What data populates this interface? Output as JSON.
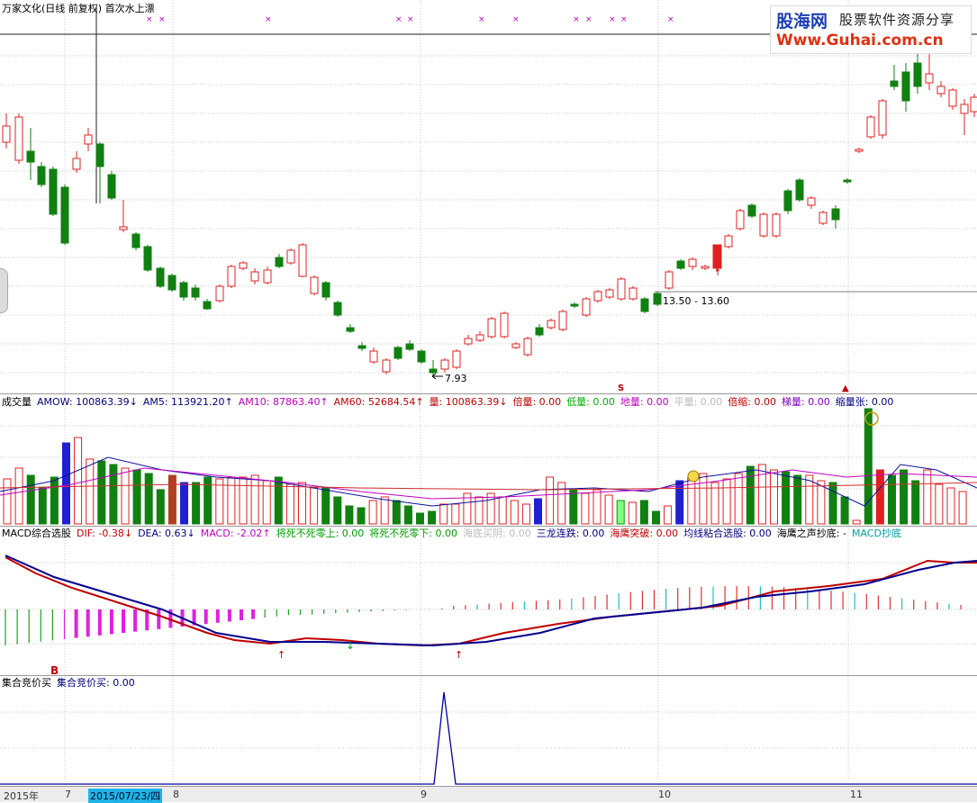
{
  "main": {
    "title": "万家文化(日线 前复权) 首次水上漂",
    "min_label": "7.93",
    "range_label": "13.50 - 13.60"
  },
  "watermark": {
    "logo": "股海网",
    "slogan": "股票软件资源分享",
    "url": "Www.Guhai.com.cn"
  },
  "volume": {
    "items": [
      {
        "label": "成交量",
        "color": "#000000"
      },
      {
        "label": "AMOW: 100863.39",
        "color": "#000080",
        "arrow": "↓"
      },
      {
        "label": "AM5: 113921.20",
        "color": "#000080",
        "arrow": "↑"
      },
      {
        "label": "AM10: 87863.40",
        "color": "#c000c0",
        "arrow": "↑"
      },
      {
        "label": "AM60: 52684.54",
        "color": "#c00000",
        "arrow": "↑"
      },
      {
        "label": "量: 100863.39",
        "color": "#c00000",
        "arrow": "↓"
      },
      {
        "label": "倍量: 0.00",
        "color": "#c00000"
      },
      {
        "label": "低量: 0.00",
        "color": "#00b000"
      },
      {
        "label": "地量: 0.00",
        "color": "#c000c0"
      },
      {
        "label": "平量: 0.00",
        "color": "#bbbbbb"
      },
      {
        "label": "倍缩: 0.00",
        "color": "#c00000"
      },
      {
        "label": "梯量: 0.00",
        "color": "#8000c0"
      },
      {
        "label": "缩量张: 0.00",
        "color": "#000080"
      }
    ]
  },
  "macd": {
    "items": [
      {
        "label": "MACD综合选股",
        "color": "#000000"
      },
      {
        "label": "DIF: -0.38",
        "color": "#c00000",
        "arrow": "↓"
      },
      {
        "label": "DEA: 0.63",
        "color": "#000080",
        "arrow": "↓"
      },
      {
        "label": "MACD: -2.02",
        "color": "#c000c0",
        "arrow": "↑"
      },
      {
        "label": "将死不死零上: 0.00",
        "color": "#00a000"
      },
      {
        "label": "将死不死零下: 0.00",
        "color": "#00a000"
      },
      {
        "label": "海底买阴: 0.00",
        "color": "#bbbbbb"
      },
      {
        "label": "三龙连跌: 0.00",
        "color": "#000080"
      },
      {
        "label": "海鹰突破: 0.00",
        "color": "#c00000"
      },
      {
        "label": "均线粘合选股: 0.00",
        "color": "#000080"
      },
      {
        "label": "海鹰之声抄底: -",
        "color": "#000000"
      },
      {
        "label": "MACD抄底",
        "color": "#00a0a0"
      }
    ],
    "marker_b": "B"
  },
  "auction": {
    "items": [
      {
        "label": "集合竞价买",
        "color": "#000000"
      },
      {
        "label": "集合竞价买: 0.00",
        "color": "#000080"
      }
    ]
  },
  "datebar": {
    "year": "2015年",
    "m7": "7",
    "current": "2015/07/23/四",
    "m8": "8",
    "m9": "9",
    "m10": "10",
    "m11": "11"
  },
  "colors": {
    "up": "#e02020",
    "down": "#108010",
    "grid": "#c8c8c8",
    "ma_dif": "#c00000",
    "ma_dea": "#000090"
  }
}
